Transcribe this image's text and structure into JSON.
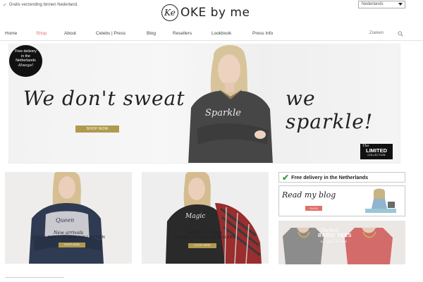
{
  "topbar": {
    "shipping_text": "Gratis verzending binnen Nederland.",
    "logo_mark": "Ke",
    "logo_word": "OKE by me",
    "language": "Nederlands"
  },
  "nav": {
    "items": [
      {
        "label": "Home",
        "active": false
      },
      {
        "label": "Shop",
        "active": true
      },
      {
        "label": "About",
        "active": false
      },
      {
        "label": "Celebs | Press",
        "active": false
      },
      {
        "label": "Blog",
        "active": false
      },
      {
        "label": "Resellers",
        "active": false
      },
      {
        "label": "Lookbook",
        "active": false
      },
      {
        "label": "Press Info",
        "active": false
      }
    ],
    "search_label": "Zoeken"
  },
  "hero": {
    "badge_lines": [
      "Free delivery",
      "in the",
      "Netherlands"
    ],
    "badge_always": "Always!",
    "slogan_left": "We don't sweat",
    "slogan_right": "we sparkle!",
    "shirt_text": "Sparkle",
    "cta": "SHOP NOW",
    "limited_the": "The",
    "limited_main": "LIMITED",
    "limited_sub": "COLLECTION"
  },
  "tiles": [
    {
      "shirt_text": "Queen",
      "script": "New arrivals",
      "main": "CHECK OUT THE NEW COLLECTION",
      "button": "SHOP NOW"
    },
    {
      "shirt_text": "Magic",
      "script": "Where to shop",
      "main": "CHECK OUT OUR RESELLERS",
      "button": "CLICK HERE"
    }
  ],
  "sidebar": {
    "free_delivery": "Free delivery in the Netherlands",
    "blog_title": "Read my blog",
    "blog_button": "CLICK",
    "tees_script": "Perfect",
    "tees_main": "BASIC TEES",
    "tees_sub": "BY OKE BY ME"
  },
  "colors": {
    "accent_pink": "#e0706a",
    "gold_button": "#b09a4e",
    "check_green": "#3aa33a"
  }
}
